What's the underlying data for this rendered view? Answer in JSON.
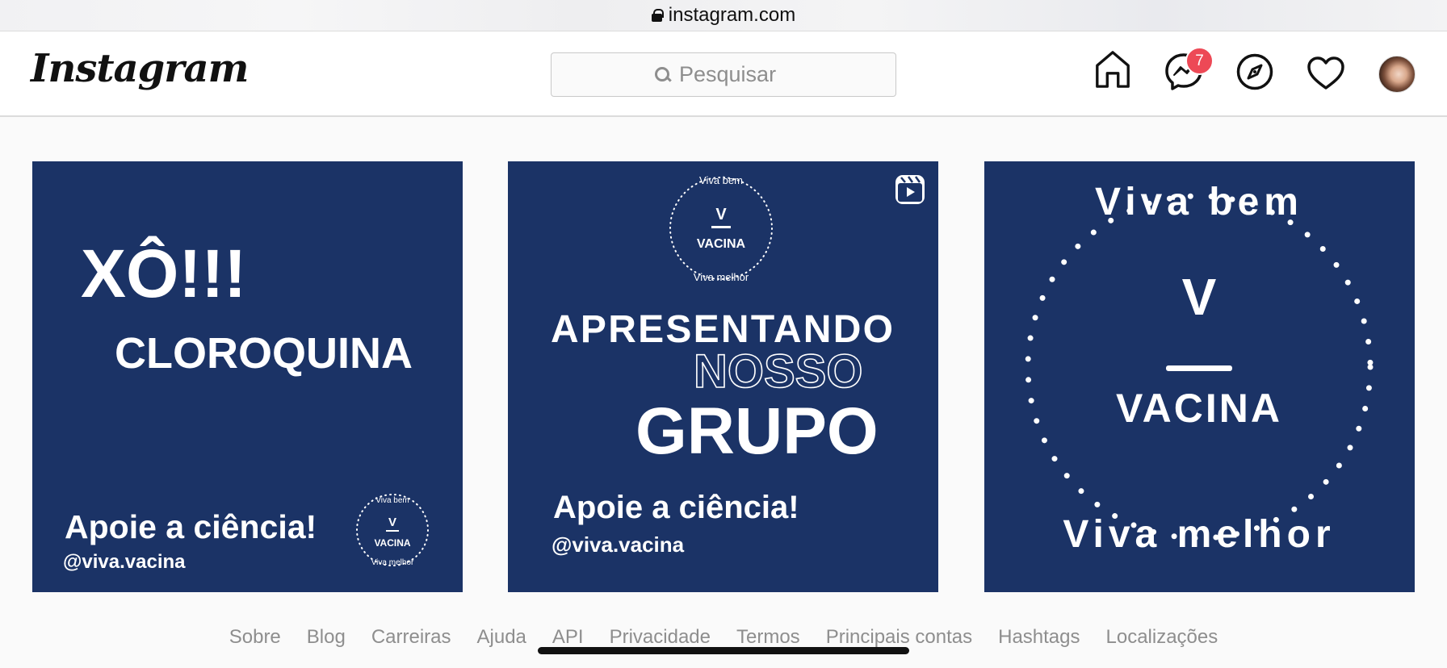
{
  "browser": {
    "url": "instagram.com"
  },
  "header": {
    "logo": "Instagram",
    "search_placeholder": "Pesquisar",
    "messages_badge": "7",
    "icons": [
      "home-icon",
      "messenger-icon",
      "explore-icon",
      "heart-icon",
      "avatar"
    ]
  },
  "posts": [
    {
      "title_line1": "XÔ!!!",
      "title_line2": "CLOROQUINA",
      "tagline": "Apoie a ciência!",
      "handle": "@viva.vacina",
      "seal_top": "Viva bem",
      "seal_letter": "V",
      "seal_word": "VACINA",
      "seal_bottom": "Viva melhor"
    },
    {
      "seal_top": "Viva bem",
      "seal_letter": "V",
      "seal_word": "VACINA",
      "seal_bottom": "Viva melhor",
      "line1": "APRESENTANDO",
      "line2": "NOSSO",
      "line3": "GRUPO",
      "tagline": "Apoie a ciência!",
      "handle": "@viva.vacina",
      "reel_icon": "reels-icon"
    },
    {
      "seal_top": "Viva bem",
      "seal_letter": "V",
      "seal_word": "VACINA",
      "seal_bottom": "Viva melhor"
    }
  ],
  "footer": {
    "links": [
      "Sobre",
      "Blog",
      "Carreiras",
      "Ajuda",
      "API",
      "Privacidade",
      "Termos",
      "Principais contas",
      "Hashtags",
      "Localizações"
    ]
  },
  "colors": {
    "post_bg": "#1b3366",
    "badge": "#ed4956"
  }
}
